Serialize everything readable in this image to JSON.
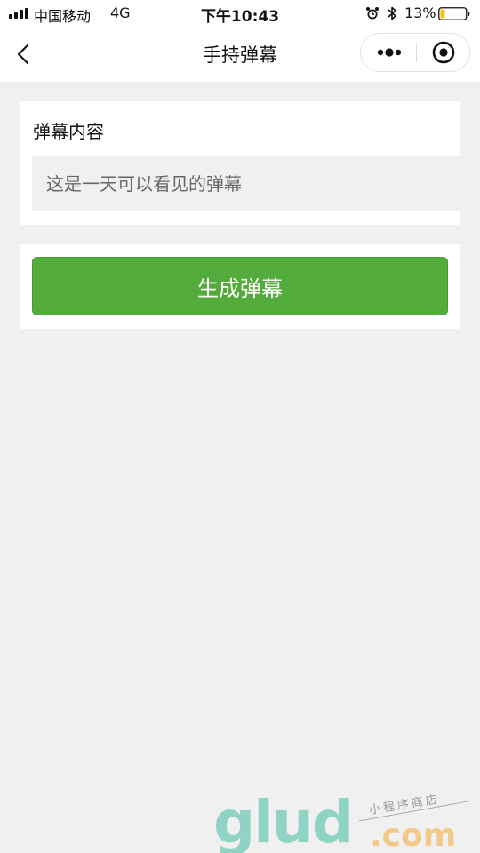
{
  "status_bar": {
    "carrier": "中国移动",
    "network": "4G",
    "time": "下午10:43",
    "battery_percent": "13%"
  },
  "nav": {
    "title": "手持弹幕"
  },
  "form": {
    "label": "弹幕内容",
    "input_placeholder": "这是一天可以看见的弹幕",
    "input_value": ""
  },
  "actions": {
    "generate_label": "生成弹幕"
  },
  "watermark": {
    "logo_text": "glud",
    "suffix": ".com",
    "tagline": "小程序商店"
  },
  "colors": {
    "primary_button": "#52ab3a",
    "page_background": "#f0f0f0",
    "battery_fill": "#f1c40f"
  },
  "icons": {
    "back": "chevron-left-icon",
    "more": "more-dots-icon",
    "close": "target-circle-icon",
    "alarm": "alarm-clock-icon",
    "bluetooth": "bluetooth-icon",
    "battery": "battery-icon",
    "signal": "signal-bars-icon"
  }
}
